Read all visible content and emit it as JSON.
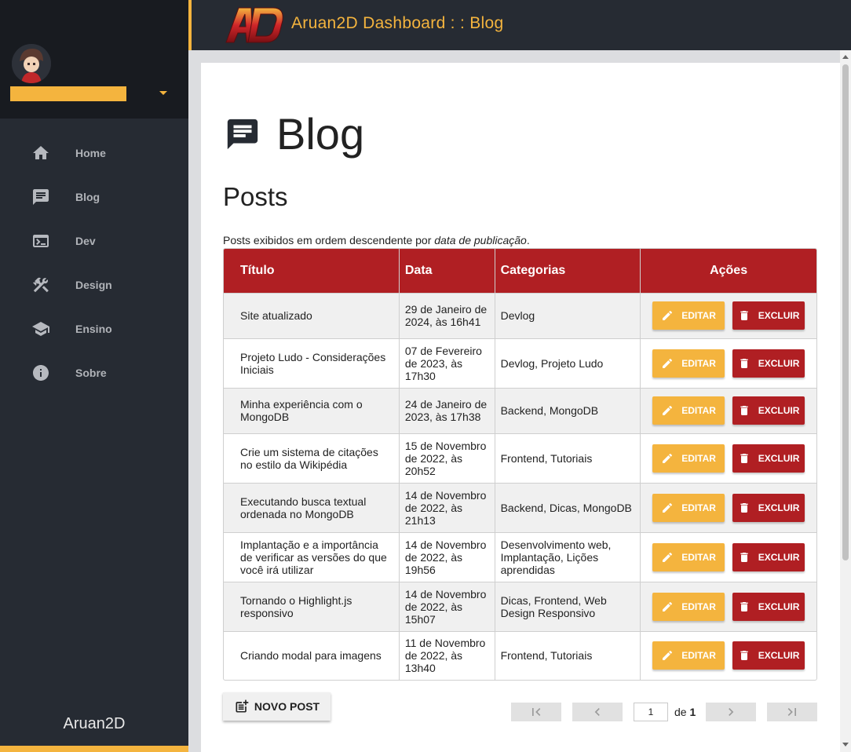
{
  "header": {
    "title": "Aruan2D Dashboard : : Blog"
  },
  "sidebar": {
    "items": [
      {
        "label": "Home",
        "icon": "home-icon"
      },
      {
        "label": "Blog",
        "icon": "chat-icon"
      },
      {
        "label": "Dev",
        "icon": "terminal-icon"
      },
      {
        "label": "Design",
        "icon": "tools-icon"
      },
      {
        "label": "Ensino",
        "icon": "school-icon"
      },
      {
        "label": "Sobre",
        "icon": "info-icon"
      }
    ],
    "footer": "Aruan2D"
  },
  "page": {
    "title": "Blog",
    "section": "Posts",
    "subtitle_prefix": "Posts exibidos em ordem descendente por ",
    "subtitle_emph": "data de publicação",
    "subtitle_suffix": "."
  },
  "table": {
    "headers": [
      "Título",
      "Data",
      "Categorias",
      "Ações"
    ],
    "rows": [
      {
        "title": "Site atualizado",
        "date": "29 de Janeiro de 2024, às 16h41",
        "categories": "Devlog"
      },
      {
        "title": "Projeto Ludo - Considerações Iniciais",
        "date": "07 de Fevereiro de 2023, às 17h30",
        "categories": "Devlog, Projeto Ludo"
      },
      {
        "title": "Minha experiência com o MongoDB",
        "date": "24 de Janeiro de 2023, às 17h38",
        "categories": "Backend, MongoDB"
      },
      {
        "title": "Crie um sistema de citações no estilo da Wikipédia",
        "date": "15 de Novembro de 2022, às 20h52",
        "categories": "Frontend, Tutoriais"
      },
      {
        "title": "Executando busca textual ordenada no MongoDB",
        "date": "14 de Novembro de 2022, às 21h13",
        "categories": "Backend, Dicas, MongoDB"
      },
      {
        "title": "Implantação e a importância de verificar as versões do que você irá utilizar",
        "date": "14 de Novembro de 2022, às 19h56",
        "categories": "Desenvolvimento web, Implantação, Lições aprendidas"
      },
      {
        "title": "Tornando o Highlight.js responsivo",
        "date": "14 de Novembro de 2022, às 15h07",
        "categories": "Dicas, Frontend, Web Design Responsivo"
      },
      {
        "title": "Criando modal para imagens",
        "date": "11 de Novembro de 2022, às 13h40",
        "categories": "Frontend, Tutoriais"
      }
    ],
    "edit_label": "EDITAR",
    "delete_label": "EXCLUIR"
  },
  "footer": {
    "new_post_label": "NOVO POST",
    "page_current": "1",
    "page_of_label": "de",
    "page_total": "1"
  },
  "colors": {
    "accent": "#f4b43e",
    "primary": "#b01f23",
    "dark": "#262b33"
  }
}
